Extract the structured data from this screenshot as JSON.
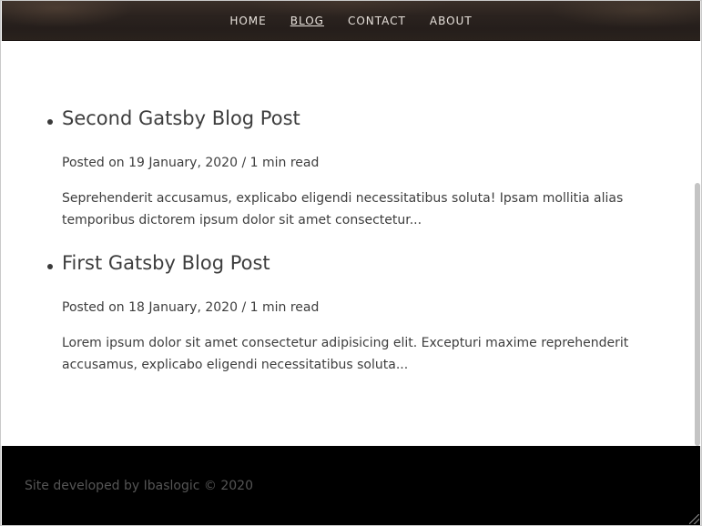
{
  "nav": {
    "items": [
      {
        "label": "HOME"
      },
      {
        "label": "BLOG"
      },
      {
        "label": "CONTACT"
      },
      {
        "label": "ABOUT"
      }
    ],
    "active": "BLOG"
  },
  "posts": [
    {
      "title": "Second Gatsby Blog Post",
      "meta": "Posted on 19 January, 2020 / 1 min read",
      "excerpt": "Seprehenderit accusamus, explicabo eligendi necessitatibus soluta! Ipsam mollitia alias temporibus dictorem ipsum dolor sit amet consectetur..."
    },
    {
      "title": "First Gatsby Blog Post",
      "meta": "Posted on 18 January, 2020 / 1 min read",
      "excerpt": "Lorem ipsum dolor sit amet consectetur adipisicing elit. Excepturi maxime reprehenderit accusamus, explicabo eligendi necessitatibus soluta..."
    }
  ],
  "footer": {
    "text": "Site developed by Ibaslogic © 2020"
  },
  "colors": {
    "nav_text": "#e8e2dc",
    "body_text": "#3d3d3d",
    "footer_bg": "#000000",
    "footer_text": "#555555"
  }
}
